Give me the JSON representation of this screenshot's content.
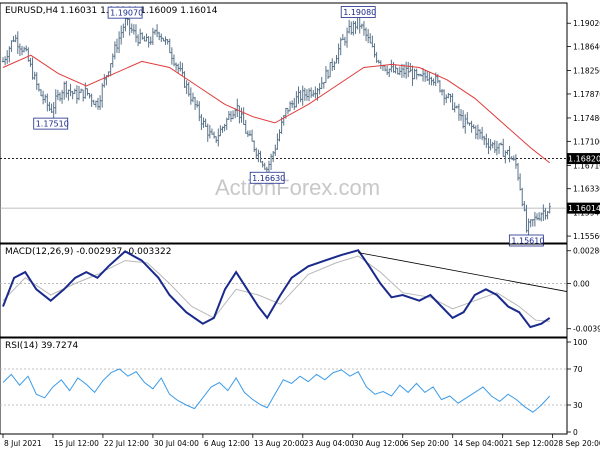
{
  "chart_data": [
    {
      "type": "candlestick",
      "symbol": "EURUSD,H4",
      "ohlc": "1.16031 1.16044 1.16009 1.16014",
      "watermark": "ActionForex.com",
      "price_ticks": [
        "1.19020",
        "1.18640",
        "1.18250",
        "1.17870",
        "1.17480",
        "1.17100",
        "1.16710",
        "1.16330",
        "1.15940",
        "1.15560"
      ],
      "ylim": [
        1.1548,
        1.193
      ],
      "support_level": 1.1682,
      "support_label": "1.16820",
      "last_price": 1.16014,
      "last_price_label": "1.16014",
      "annotations": [
        {
          "label": "1.17510",
          "t": 0.086,
          "price": 1.1751
        },
        {
          "label": "1.19070",
          "t": 0.22,
          "price": 1.1907
        },
        {
          "label": "1.16630",
          "t": 0.476,
          "price": 1.1663
        },
        {
          "label": "1.19080",
          "t": 0.64,
          "price": 1.1908
        },
        {
          "label": "1.15610",
          "t": 0.943,
          "price": 1.1561
        }
      ],
      "close_path": [
        [
          0.0,
          1.184
        ],
        [
          0.02,
          1.188
        ],
        [
          0.04,
          1.1855
        ],
        [
          0.065,
          1.179
        ],
        [
          0.086,
          1.176
        ],
        [
          0.11,
          1.18
        ],
        [
          0.13,
          1.1785
        ],
        [
          0.15,
          1.179
        ],
        [
          0.17,
          1.177
        ],
        [
          0.19,
          1.183
        ],
        [
          0.21,
          1.188
        ],
        [
          0.22,
          1.1905
        ],
        [
          0.24,
          1.188
        ],
        [
          0.26,
          1.187
        ],
        [
          0.28,
          1.189
        ],
        [
          0.3,
          1.186
        ],
        [
          0.32,
          1.182
        ],
        [
          0.34,
          1.178
        ],
        [
          0.36,
          1.174
        ],
        [
          0.38,
          1.171
        ],
        [
          0.4,
          1.174
        ],
        [
          0.42,
          1.177
        ],
        [
          0.44,
          1.172
        ],
        [
          0.46,
          1.169
        ],
        [
          0.476,
          1.1665
        ],
        [
          0.49,
          1.17
        ],
        [
          0.51,
          1.176
        ],
        [
          0.53,
          1.178
        ],
        [
          0.55,
          1.179
        ],
        [
          0.57,
          1.18
        ],
        [
          0.59,
          1.183
        ],
        [
          0.61,
          1.187
        ],
        [
          0.625,
          1.189
        ],
        [
          0.64,
          1.1905
        ],
        [
          0.655,
          1.188
        ],
        [
          0.67,
          1.185
        ],
        [
          0.69,
          1.183
        ],
        [
          0.71,
          1.182
        ],
        [
          0.73,
          1.1825
        ],
        [
          0.75,
          1.181
        ],
        [
          0.77,
          1.182
        ],
        [
          0.79,
          1.1795
        ],
        [
          0.81,
          1.177
        ],
        [
          0.83,
          1.174
        ],
        [
          0.85,
          1.173
        ],
        [
          0.87,
          1.171
        ],
        [
          0.89,
          1.17
        ],
        [
          0.91,
          1.169
        ],
        [
          0.925,
          1.167
        ],
        [
          0.935,
          1.162
        ],
        [
          0.943,
          1.1565
        ],
        [
          0.955,
          1.158
        ],
        [
          0.97,
          1.1595
        ],
        [
          0.985,
          1.1601
        ]
      ],
      "moving_average": [
        [
          0.0,
          1.183
        ],
        [
          0.05,
          1.185
        ],
        [
          0.1,
          1.182
        ],
        [
          0.15,
          1.18
        ],
        [
          0.2,
          1.182
        ],
        [
          0.25,
          1.184
        ],
        [
          0.3,
          1.183
        ],
        [
          0.35,
          1.18
        ],
        [
          0.4,
          1.177
        ],
        [
          0.45,
          1.175
        ],
        [
          0.49,
          1.174
        ],
        [
          0.55,
          1.177
        ],
        [
          0.6,
          1.18
        ],
        [
          0.65,
          1.183
        ],
        [
          0.7,
          1.1835
        ],
        [
          0.75,
          1.183
        ],
        [
          0.8,
          1.181
        ],
        [
          0.85,
          1.178
        ],
        [
          0.9,
          1.174
        ],
        [
          0.95,
          1.17
        ],
        [
          0.985,
          1.1675
        ]
      ]
    },
    {
      "type": "line",
      "title": "MACD(12,26,9) -0.002937 -0.003322",
      "y_ticks": [
        "0.002861",
        "0.00",
        "-0.00394"
      ],
      "ylim": [
        -0.0044,
        0.0031
      ],
      "zero": 0,
      "macd": [
        [
          0.0,
          -0.002
        ],
        [
          0.02,
          0.0005
        ],
        [
          0.04,
          0.001
        ],
        [
          0.06,
          -0.0005
        ],
        [
          0.086,
          -0.0015
        ],
        [
          0.11,
          -0.0005
        ],
        [
          0.13,
          0.0005
        ],
        [
          0.15,
          0.001
        ],
        [
          0.17,
          0.0005
        ],
        [
          0.19,
          0.0015
        ],
        [
          0.22,
          0.0028
        ],
        [
          0.25,
          0.002
        ],
        [
          0.28,
          0.0005
        ],
        [
          0.3,
          -0.001
        ],
        [
          0.33,
          -0.0025
        ],
        [
          0.36,
          -0.0035
        ],
        [
          0.38,
          -0.003
        ],
        [
          0.4,
          -0.0005
        ],
        [
          0.42,
          0.001
        ],
        [
          0.44,
          -0.0005
        ],
        [
          0.46,
          -0.002
        ],
        [
          0.476,
          -0.003
        ],
        [
          0.5,
          -0.001
        ],
        [
          0.52,
          0.0005
        ],
        [
          0.55,
          0.0015
        ],
        [
          0.58,
          0.002
        ],
        [
          0.61,
          0.0025
        ],
        [
          0.64,
          0.0029
        ],
        [
          0.66,
          0.0015
        ],
        [
          0.68,
          0.0
        ],
        [
          0.7,
          -0.0012
        ],
        [
          0.72,
          -0.001
        ],
        [
          0.75,
          -0.0015
        ],
        [
          0.77,
          -0.001
        ],
        [
          0.79,
          -0.002
        ],
        [
          0.81,
          -0.003
        ],
        [
          0.83,
          -0.0025
        ],
        [
          0.85,
          -0.001
        ],
        [
          0.87,
          -0.0005
        ],
        [
          0.89,
          -0.001
        ],
        [
          0.91,
          -0.002
        ],
        [
          0.93,
          -0.0025
        ],
        [
          0.95,
          -0.0038
        ],
        [
          0.97,
          -0.0035
        ],
        [
          0.985,
          -0.003
        ]
      ],
      "signal": [
        [
          0.0,
          -0.0015
        ],
        [
          0.04,
          0.0005
        ],
        [
          0.086,
          -0.001
        ],
        [
          0.13,
          0.0
        ],
        [
          0.17,
          0.0008
        ],
        [
          0.22,
          0.002
        ],
        [
          0.26,
          0.0018
        ],
        [
          0.3,
          0.0
        ],
        [
          0.34,
          -0.002
        ],
        [
          0.38,
          -0.003
        ],
        [
          0.42,
          -0.0005
        ],
        [
          0.46,
          -0.001
        ],
        [
          0.5,
          -0.0018
        ],
        [
          0.55,
          0.0008
        ],
        [
          0.6,
          0.0018
        ],
        [
          0.64,
          0.0024
        ],
        [
          0.68,
          0.001
        ],
        [
          0.72,
          -0.0008
        ],
        [
          0.77,
          -0.0012
        ],
        [
          0.81,
          -0.0022
        ],
        [
          0.85,
          -0.0015
        ],
        [
          0.89,
          -0.0008
        ],
        [
          0.93,
          -0.002
        ],
        [
          0.96,
          -0.0032
        ],
        [
          0.985,
          -0.0033
        ]
      ],
      "trendline": [
        [
          0.64,
          0.0027
        ],
        [
          0.985,
          -0.0007
        ]
      ]
    },
    {
      "type": "line",
      "title": "RSI(14) 39.7274",
      "y_ticks": [
        "100",
        "70",
        "30",
        "0"
      ],
      "levels": [
        70,
        30
      ],
      "ylim": [
        0,
        100
      ],
      "rsi": [
        [
          0.0,
          55
        ],
        [
          0.015,
          64
        ],
        [
          0.03,
          52
        ],
        [
          0.045,
          62
        ],
        [
          0.06,
          42
        ],
        [
          0.075,
          38
        ],
        [
          0.09,
          50
        ],
        [
          0.105,
          58
        ],
        [
          0.12,
          46
        ],
        [
          0.135,
          60
        ],
        [
          0.15,
          53
        ],
        [
          0.165,
          44
        ],
        [
          0.18,
          57
        ],
        [
          0.195,
          66
        ],
        [
          0.21,
          70
        ],
        [
          0.225,
          62
        ],
        [
          0.24,
          67
        ],
        [
          0.255,
          55
        ],
        [
          0.27,
          48
        ],
        [
          0.285,
          60
        ],
        [
          0.3,
          42
        ],
        [
          0.315,
          35
        ],
        [
          0.33,
          30
        ],
        [
          0.345,
          26
        ],
        [
          0.36,
          38
        ],
        [
          0.375,
          50
        ],
        [
          0.39,
          55
        ],
        [
          0.405,
          46
        ],
        [
          0.42,
          60
        ],
        [
          0.435,
          44
        ],
        [
          0.45,
          36
        ],
        [
          0.465,
          30
        ],
        [
          0.476,
          27
        ],
        [
          0.49,
          42
        ],
        [
          0.505,
          58
        ],
        [
          0.52,
          54
        ],
        [
          0.535,
          62
        ],
        [
          0.55,
          56
        ],
        [
          0.565,
          64
        ],
        [
          0.58,
          58
        ],
        [
          0.595,
          66
        ],
        [
          0.61,
          69
        ],
        [
          0.625,
          62
        ],
        [
          0.64,
          67
        ],
        [
          0.655,
          50
        ],
        [
          0.67,
          42
        ],
        [
          0.685,
          45
        ],
        [
          0.7,
          40
        ],
        [
          0.715,
          52
        ],
        [
          0.73,
          44
        ],
        [
          0.745,
          54
        ],
        [
          0.76,
          44
        ],
        [
          0.775,
          50
        ],
        [
          0.79,
          36
        ],
        [
          0.805,
          40
        ],
        [
          0.82,
          32
        ],
        [
          0.835,
          38
        ],
        [
          0.85,
          44
        ],
        [
          0.865,
          50
        ],
        [
          0.88,
          40
        ],
        [
          0.895,
          34
        ],
        [
          0.91,
          42
        ],
        [
          0.925,
          36
        ],
        [
          0.94,
          28
        ],
        [
          0.955,
          22
        ],
        [
          0.97,
          30
        ],
        [
          0.985,
          40
        ]
      ]
    }
  ],
  "time_axis": [
    "8 Jul 2021",
    "15 Jul 12:00",
    "22 Jul 12:00",
    "30 Jul 04:00",
    "6 Aug 12:00",
    "13 Aug 20:00",
    "23 Aug 04:00",
    "30 Aug 12:00",
    "6 Sep 20:00",
    "14 Sep 04:00",
    "21 Sep 12:00",
    "28 Sep 20:00"
  ],
  "colors": {
    "price_line": "#5a7389",
    "ma": "#e03a3a",
    "macd": "#1a2a8c",
    "signal": "#b8b8b8",
    "rsi": "#3c9be8",
    "label_border": "#1a2a8c",
    "label_text": "#1a2a8c",
    "grid": "#b0b0b0"
  }
}
